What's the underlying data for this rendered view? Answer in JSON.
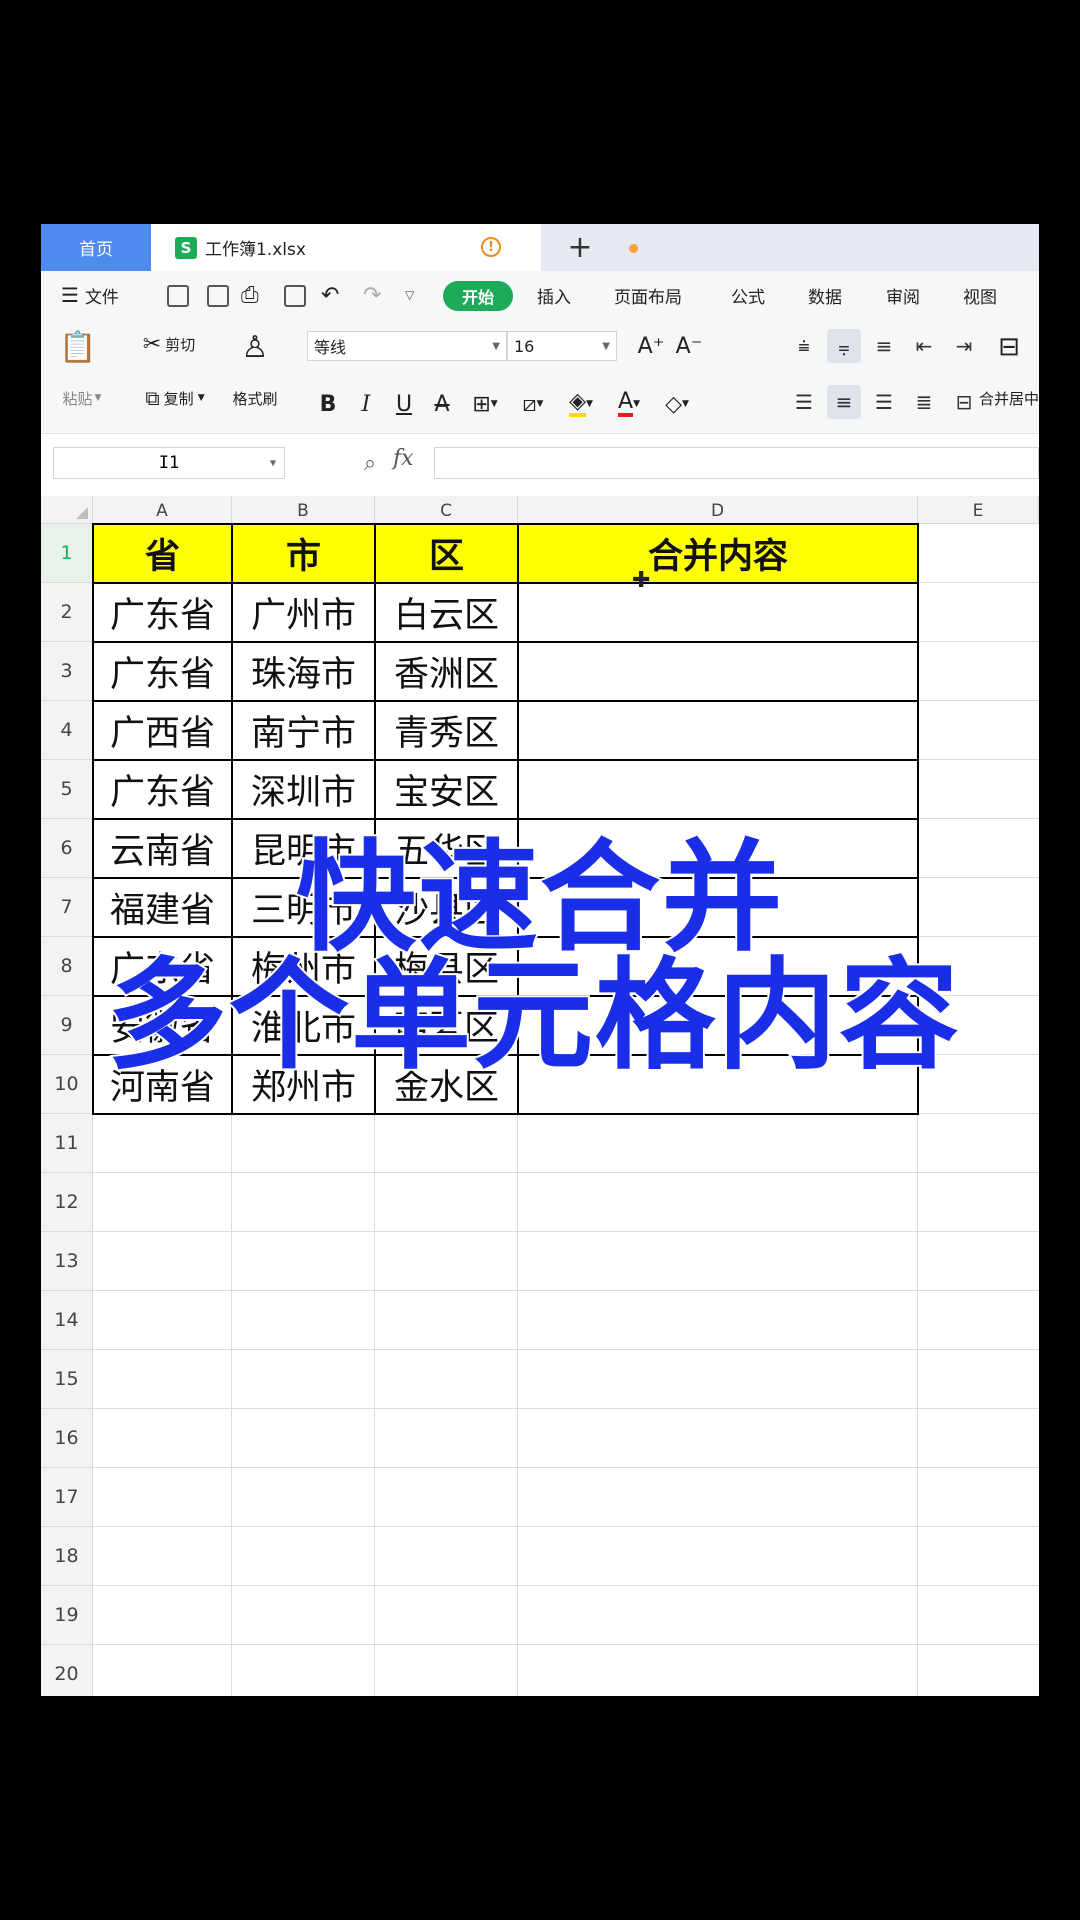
{
  "tabs": {
    "home": "首页",
    "doc_icon": "S",
    "document": "工作簿1.xlsx",
    "warn_icon": "!",
    "add": "+"
  },
  "menu": {
    "file": "文件",
    "items": [
      "开始",
      "插入",
      "页面布局",
      "公式",
      "数据",
      "审阅",
      "视图"
    ]
  },
  "ribbon": {
    "paste": "粘贴",
    "cut": "剪切",
    "copy": "复制",
    "format_painter": "格式刷",
    "font_name": "等线",
    "font_size": "16",
    "grow_font": "A⁺",
    "shrink_font": "A⁻",
    "bold": "B",
    "italic": "I",
    "underline": "U",
    "strikethrough": "A",
    "merge_center": "合并居中"
  },
  "formula_bar": {
    "cell_ref": "I1",
    "fx": "fx",
    "formula": ""
  },
  "columns": [
    "A",
    "B",
    "C",
    "D",
    "E"
  ],
  "rows": [
    "1",
    "2",
    "3",
    "4",
    "5",
    "6",
    "7",
    "8",
    "9",
    "10",
    "11",
    "12",
    "13",
    "14",
    "15",
    "16",
    "17",
    "18",
    "19",
    "20"
  ],
  "table": {
    "headers": [
      "省",
      "市",
      "区",
      "合并内容"
    ],
    "data": [
      [
        "广东省",
        "广州市",
        "白云区",
        ""
      ],
      [
        "广东省",
        "珠海市",
        "香洲区",
        ""
      ],
      [
        "广西省",
        "南宁市",
        "青秀区",
        ""
      ],
      [
        "广东省",
        "深圳市",
        "宝安区",
        ""
      ],
      [
        "云南省",
        "昆明市",
        "五华区",
        ""
      ],
      [
        "福建省",
        "三明市",
        "沙县区",
        ""
      ],
      [
        "广东省",
        "梅州市",
        "梅县区",
        ""
      ],
      [
        "安徽省",
        "淮北市",
        "西夏区",
        ""
      ],
      [
        "河南省",
        "郑州市",
        "金水区",
        ""
      ]
    ]
  },
  "overlay": {
    "line1": "快速合并",
    "line2": "多个单元格内容"
  },
  "colors": {
    "accent_green": "#1dab5a",
    "home_tab_blue": "#4f8bef",
    "header_fill": "#ffff00",
    "overlay_text": "#1a2ee8"
  }
}
